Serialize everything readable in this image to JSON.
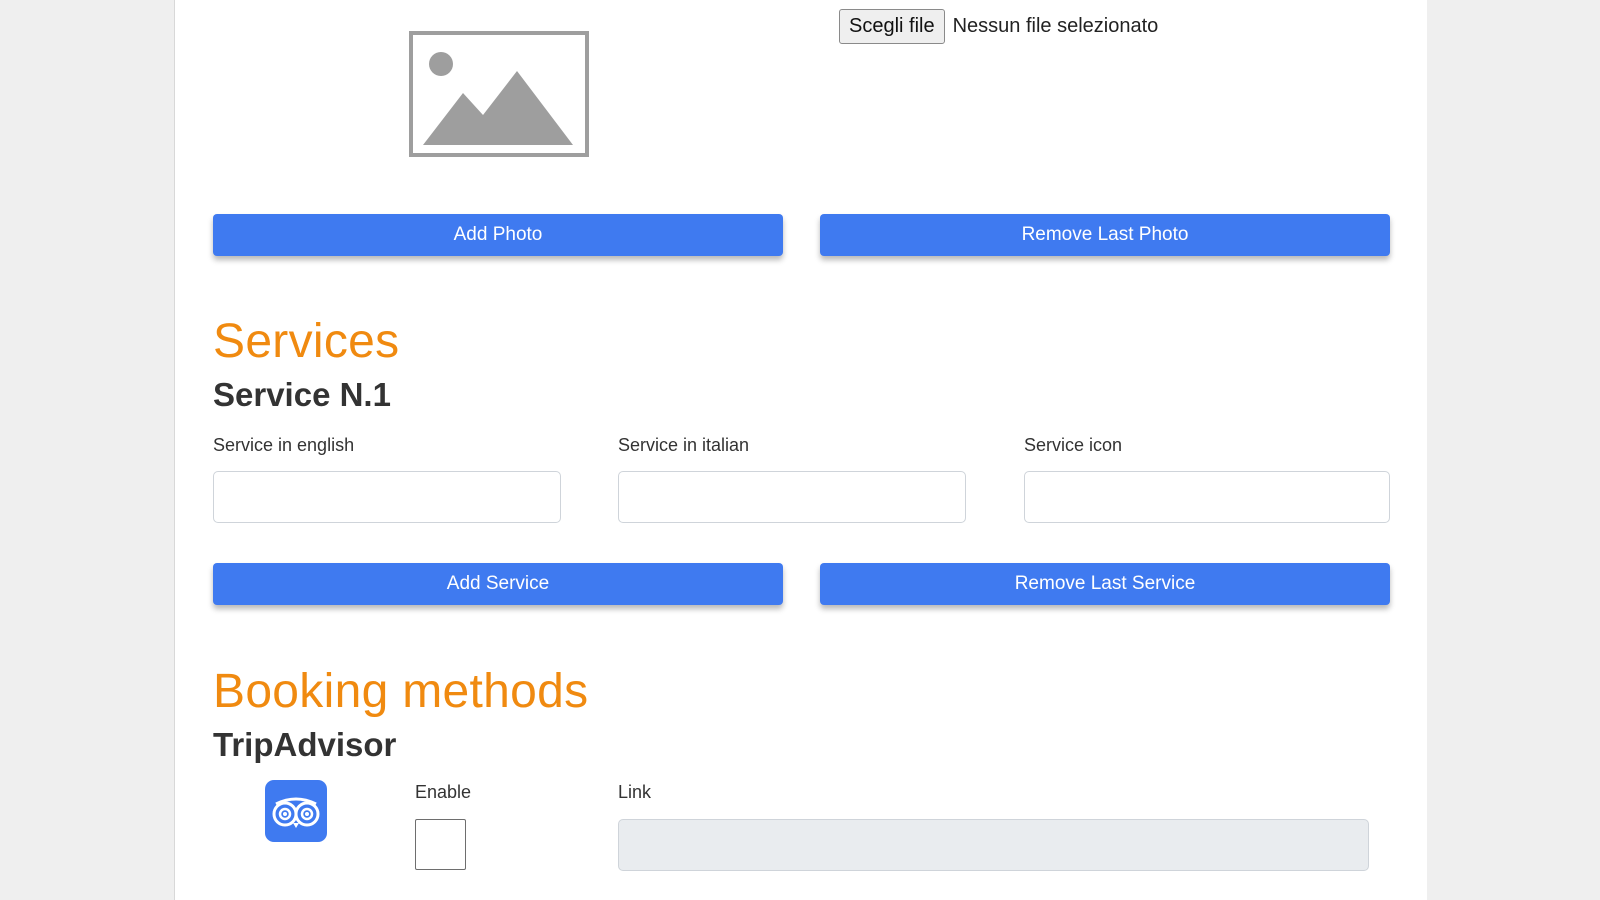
{
  "photos": {
    "placeholder_icon": "image-placeholder-icon",
    "file_input": {
      "button_label": "Scegli file",
      "status_text": "Nessun file selezionato"
    },
    "add_button": "Add Photo",
    "remove_button": "Remove Last Photo"
  },
  "services": {
    "title": "Services",
    "item_title": "Service N.1",
    "fields": [
      {
        "label": "Service in english",
        "value": ""
      },
      {
        "label": "Service in italian",
        "value": ""
      },
      {
        "label": "Service icon",
        "value": ""
      }
    ],
    "add_button": "Add Service",
    "remove_button": "Remove Last Service"
  },
  "booking": {
    "title": "Booking methods",
    "method_title": "TripAdvisor",
    "icon": "tripadvisor-owl-icon",
    "enable_label": "Enable",
    "enable_checked": false,
    "link_label": "Link",
    "link_value": ""
  },
  "colors": {
    "accent_orange": "#f08a10",
    "button_blue": "#3f7af0",
    "page_background": "#efefef"
  }
}
